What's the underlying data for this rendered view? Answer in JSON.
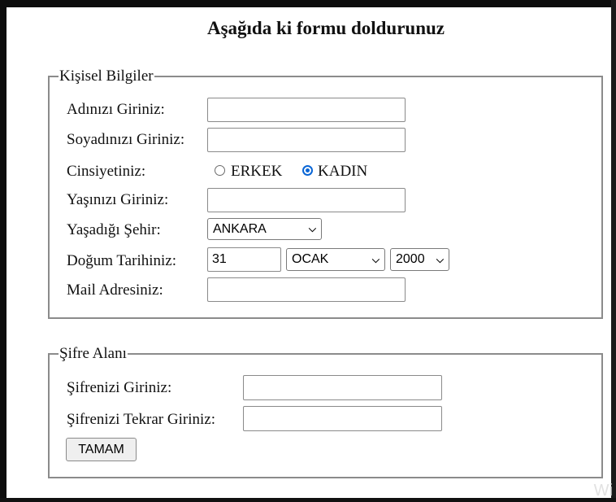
{
  "page": {
    "title": "Aşağıda ki formu doldurunuz",
    "watermark": "Wi"
  },
  "personal": {
    "legend": "Kişisel Bilgiler",
    "name_label": "Adınızı Giriniz:",
    "name_value": "",
    "surname_label": "Soyadınızı Giriniz:",
    "surname_value": "",
    "gender_label": "Cinsiyetiniz:",
    "gender_options": [
      "ERKEK",
      "KADIN"
    ],
    "gender_selected": "KADIN",
    "age_label": "Yaşınızı Giriniz:",
    "age_value": "",
    "city_label": "Yaşadığı Şehir:",
    "city_value": "ANKARA",
    "birth_label": "Doğum Tarihiniz:",
    "birth_day": "31",
    "birth_month": "OCAK",
    "birth_year": "2000",
    "mail_label": "Mail Adresiniz:",
    "mail_value": ""
  },
  "password": {
    "legend": "Şifre Alanı",
    "password_label": "Şifrenizi Giriniz:",
    "password_value": "",
    "confirm_label": "Şifrenizi Tekrar Giriniz:",
    "confirm_value": "",
    "submit_label": "TAMAM"
  },
  "colors": {
    "radio_accent": "#0a66d6",
    "fieldset_border": "#8b8b8b",
    "frame": "#0d0d0d"
  }
}
